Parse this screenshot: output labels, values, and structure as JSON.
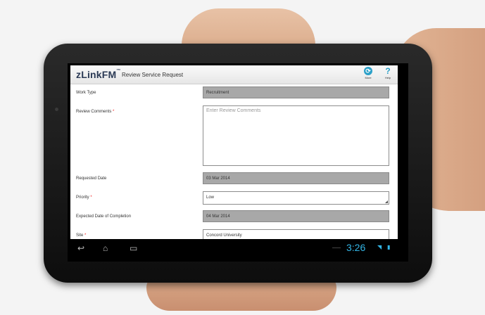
{
  "app": {
    "logo": "zLinkFM",
    "logo_tm": "™",
    "title": "Review Service Request",
    "actions": [
      {
        "label": "More",
        "icon": "more-icon"
      },
      {
        "label": "Help",
        "icon": "help-icon",
        "glyph": "?"
      }
    ]
  },
  "form": {
    "work_type": {
      "label": "Work Type",
      "value": "Recruitment"
    },
    "review_comments": {
      "label": "Review Comments",
      "placeholder": "Enter Review Comments"
    },
    "requested_date": {
      "label": "Requested Date",
      "value": "03 Mar 2014"
    },
    "priority": {
      "label": "Priority",
      "value": "Low"
    },
    "expected_date": {
      "label": "Expected Date of Completion",
      "value": "04 Mar 2014"
    },
    "site": {
      "label": "Site",
      "value": "Concord University"
    },
    "required_mark": "*"
  },
  "system_bar": {
    "time": "3:26",
    "icons": [
      "back-icon",
      "home-icon",
      "recents-icon",
      "wifi-icon",
      "battery-icon"
    ]
  },
  "colors": {
    "accent": "#33b5e5",
    "readonly_field": "#a8a8a8",
    "required": "#ee2222"
  }
}
